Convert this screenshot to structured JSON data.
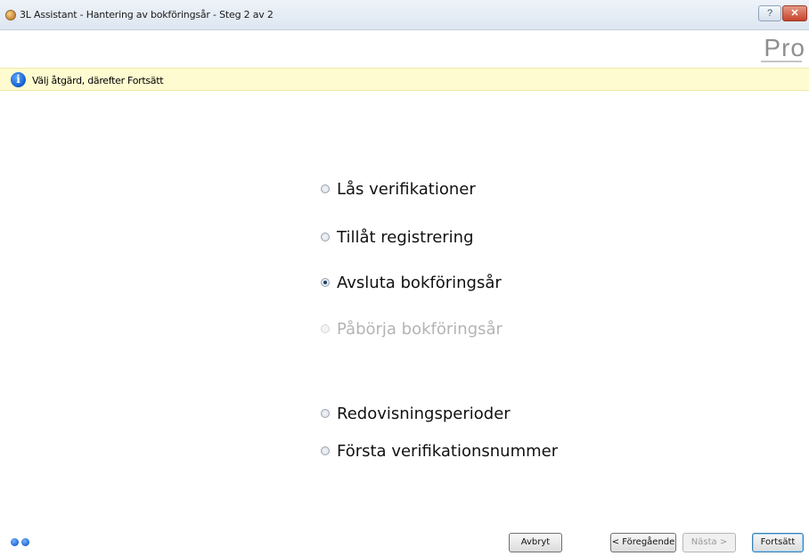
{
  "window": {
    "title": "3L Assistant - Hantering av bokföringsår - Steg 2 av 2",
    "help_label": "?",
    "close_label": "✕"
  },
  "brand": {
    "logo_text": "Pro"
  },
  "info": {
    "icon": "info-icon",
    "message": "Välj åtgärd, därefter Fortsätt"
  },
  "options": [
    {
      "label": "Lås verifikationer",
      "selected": false,
      "enabled": true
    },
    {
      "label": "Tillåt registrering",
      "selected": false,
      "enabled": true
    },
    {
      "label": "Avsluta bokföringsår",
      "selected": true,
      "enabled": true
    },
    {
      "label": "Påbörja bokföringsår",
      "selected": false,
      "enabled": false
    },
    {
      "label": "Redovisningsperioder",
      "selected": false,
      "enabled": true
    },
    {
      "label": "Första verifikationsnummer",
      "selected": false,
      "enabled": true
    }
  ],
  "buttons": {
    "cancel": "Avbryt",
    "previous": "< Föregående",
    "next": "Nästa >",
    "continue": "Fortsätt"
  }
}
